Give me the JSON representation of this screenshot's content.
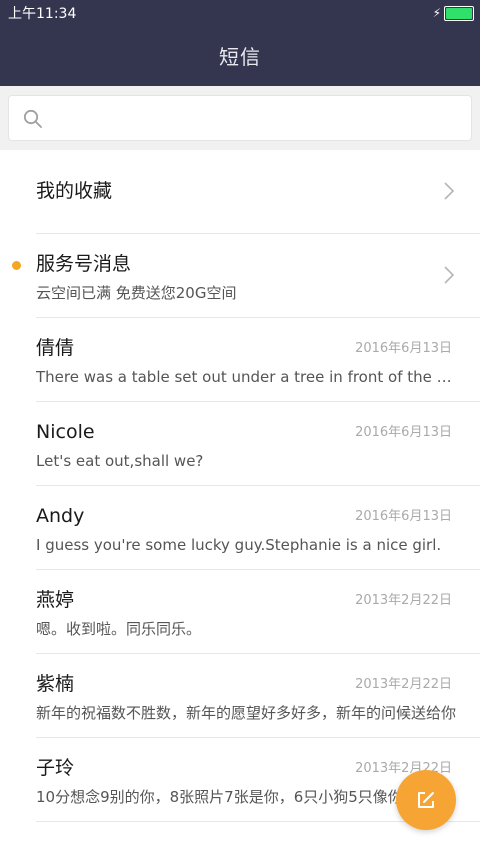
{
  "status_bar": {
    "time": "上午11:34"
  },
  "header": {
    "title": "短信"
  },
  "search": {
    "placeholder": ""
  },
  "colors": {
    "header_bg": "#343650",
    "accent": "#f6a534",
    "unread_dot": "#f5a623",
    "battery": "#2fe06a"
  },
  "icons": {
    "search": "search-icon",
    "chevron": "chevron-right-icon",
    "compose": "compose-icon",
    "charging": "lightning-icon",
    "battery": "battery-icon"
  },
  "list": {
    "favorites": {
      "name": "我的收藏"
    },
    "service": {
      "name": "服务号消息",
      "preview": "云空间已满 免费送您20G空间",
      "unread": true
    },
    "conversations": [
      {
        "name": "倩倩",
        "date": "2016年6月13日",
        "preview": "There was a table set out under a tree in front of the house"
      },
      {
        "name": "Nicole",
        "date": "2016年6月13日",
        "preview": "Let's eat out,shall we?"
      },
      {
        "name": "Andy",
        "date": "2016年6月13日",
        "preview": "I guess you're some lucky guy.Stephanie is a nice girl."
      },
      {
        "name": "燕婷",
        "date": "2013年2月22日",
        "preview": "嗯。收到啦。同乐同乐。"
      },
      {
        "name": "紫楠",
        "date": "2013年2月22日",
        "preview": "新年的祝福数不胜数，新年的愿望好多好多，新年的问候送给你"
      },
      {
        "name": "子玲",
        "date": "2013年2月22日",
        "preview": "10分想念9别的你，8张照片7张是你，6只小狗5只像你"
      }
    ]
  }
}
